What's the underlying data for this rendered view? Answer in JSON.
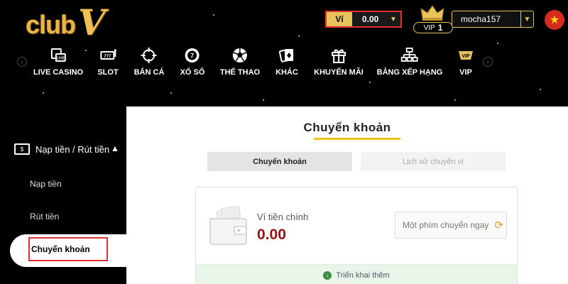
{
  "header": {
    "logo_text": "club",
    "logo_letter": "V",
    "wallet": {
      "label": "Ví",
      "amount": "0.00"
    },
    "vip": {
      "prefix": "VIP",
      "level": "1"
    },
    "username": "mocha157",
    "language_flag": "vietnam-flag"
  },
  "nav": {
    "items": [
      {
        "label": "LIVE CASINO",
        "icon": "live-casino-icon"
      },
      {
        "label": "SLOT",
        "icon": "slot-icon"
      },
      {
        "label": "BẮN CÁ",
        "icon": "crosshair-icon"
      },
      {
        "label": "XỔ SỐ",
        "icon": "lottery-ball-icon"
      },
      {
        "label": "THỂ THAO",
        "icon": "soccer-ball-icon"
      },
      {
        "label": "KHÁC",
        "icon": "cards-icon"
      },
      {
        "label": "KHUYẾN MÃI",
        "icon": "gift-icon"
      },
      {
        "label": "BẢNG XẾP HẠNG",
        "icon": "ranking-icon"
      },
      {
        "label": "VIP",
        "icon": "vip-icon"
      }
    ]
  },
  "sidebar": {
    "section_title": "Nạp tiền / Rút tiền",
    "items": [
      {
        "label": "Nạp tiền"
      },
      {
        "label": "Rút tiền"
      },
      {
        "label": "Chuyển khoản"
      }
    ]
  },
  "main": {
    "title": "Chuyển khoản",
    "tabs": [
      {
        "label": "Chuyển khoản"
      },
      {
        "label": "Lịch sử chuyển ví"
      }
    ],
    "wallet_card": {
      "label": "Ví tiền chính",
      "amount": "0.00",
      "transfer_button": "Một phím chuyển ngay",
      "expand_label": "Triển khai thêm"
    }
  },
  "colors": {
    "accent_gold": "#e8c25a",
    "highlight_red": "#e03030",
    "amount_red": "#9b0f0f",
    "title_underline": "#f0c419"
  }
}
